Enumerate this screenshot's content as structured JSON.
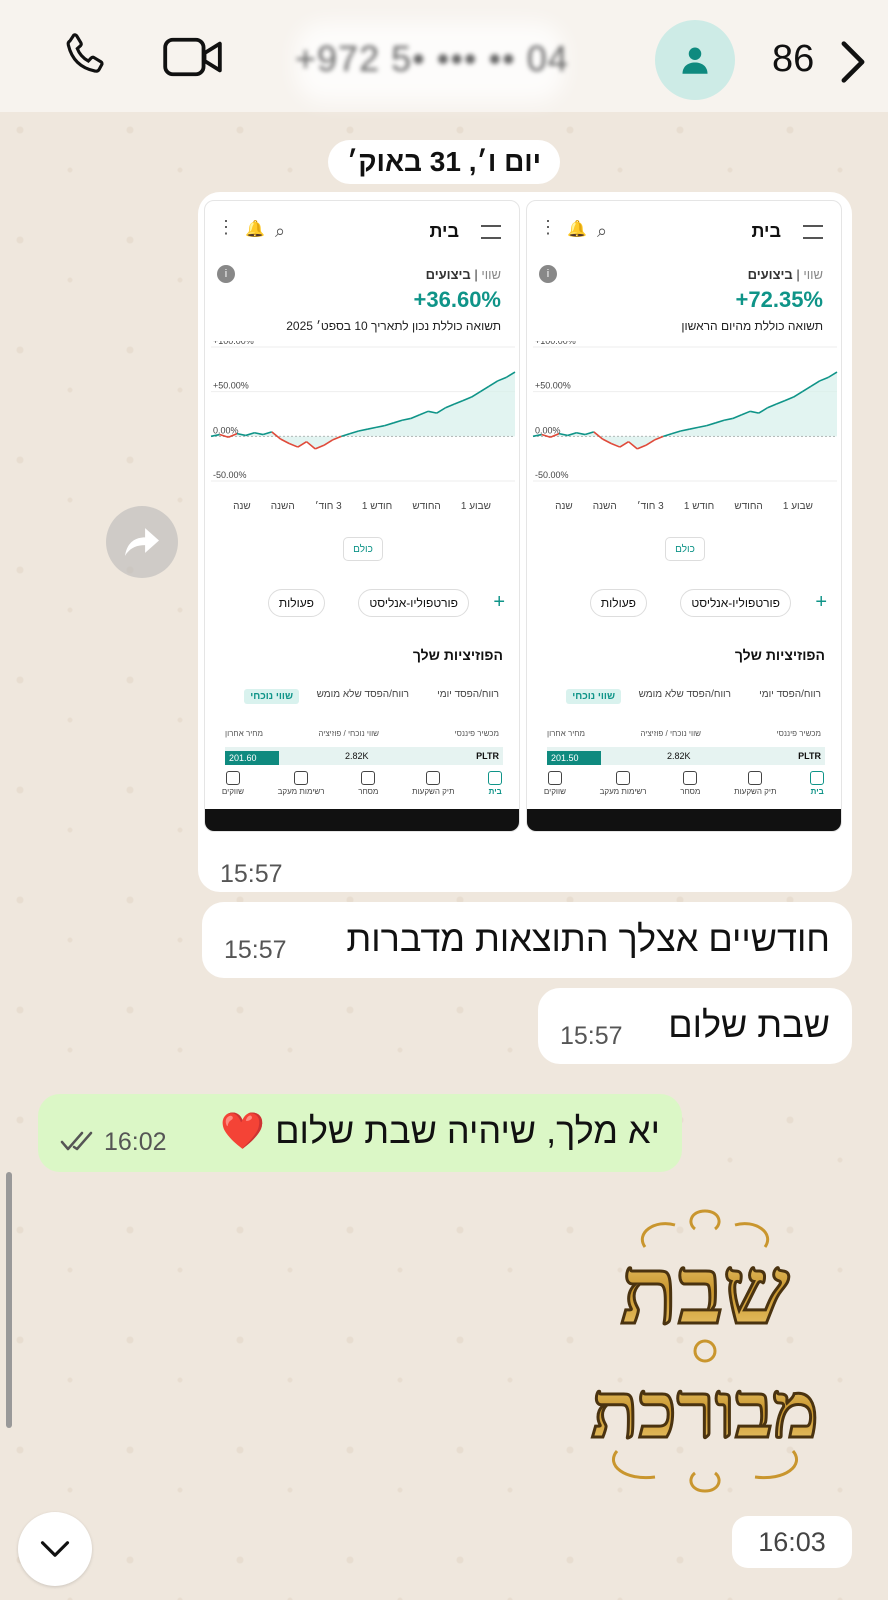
{
  "header": {
    "phone_number": "+972 5• ••• •• 04",
    "unread_count": "86",
    "icons": [
      "phone-icon",
      "video-icon",
      "avatar-icon",
      "chevron-right-icon"
    ]
  },
  "date_separator": "יום ו׳, 31 באוק׳",
  "image_message": {
    "time": "15:57",
    "screenshots": [
      {
        "title": "בית",
        "tab_active": "ביצועים",
        "tab_other": "שווי",
        "percent": "+72.35%",
        "note": "תשואה כוללת מהיום הראשון",
        "y_labels": [
          "+100.00%",
          "+50.00%",
          "0.00%",
          "-50.00%"
        ],
        "chart_data": {
          "type": "line",
          "title": "",
          "ylabel": "",
          "ylim": [
            -50,
            100
          ],
          "series": [
            {
              "values": [
                0,
                2,
                -1,
                3,
                1,
                4,
                2,
                5,
                -3,
                -8,
                -12,
                -6,
                -14,
                -10,
                -4,
                0,
                3,
                6,
                8,
                10,
                12,
                15,
                18,
                20,
                24,
                28,
                26,
                32,
                36,
                40,
                44,
                50,
                56,
                62,
                66,
                72
              ]
            }
          ]
        }
      },
      {
        "title": "בית",
        "tab_active": "ביצועים",
        "tab_other": "שווי",
        "percent": "+36.60%",
        "note": "תשואה כוללת נכון לתאריך 10 בספט׳ 2025",
        "y_labels": [
          "+100.00%",
          "+50.00%",
          "0.00%",
          "-50.00%"
        ],
        "chart_data": {
          "type": "line",
          "title": "",
          "ylabel": "",
          "ylim": [
            -50,
            100
          ],
          "series": [
            {
              "values": [
                0,
                2,
                -1,
                3,
                1,
                4,
                2,
                5,
                -3,
                -8,
                -12,
                -6,
                -14,
                -10,
                -4,
                0,
                3,
                6,
                8,
                10,
                12,
                15,
                18,
                20,
                24,
                28,
                26,
                32,
                36,
                40,
                44,
                50,
                56,
                62,
                66,
                72
              ]
            }
          ]
        }
      }
    ],
    "range_labels": [
      "שבוע 1",
      "החודש",
      "חודש 1",
      "3 חוד׳",
      "השנה",
      "שנה"
    ],
    "all_button": "כולם",
    "chips": [
      "פורטפוליו-אנליסט",
      "פעולות"
    ],
    "positions_title": "הפוזיציות שלך",
    "position_tabs": [
      "רווח/הפסד יומי",
      "רווח/הפסד שלא מומש",
      "שווי נוכחי"
    ],
    "columns": [
      "מכשיר פיננסי",
      "שווי נוכחי / פוזיציה",
      "מחיר אחרון"
    ],
    "row_prices": [
      "201.50",
      "201.60"
    ],
    "row_value": "2.82K",
    "row_symbol": "PLTR",
    "nav": [
      "בית",
      "תיק השקעות",
      "מסחר",
      "רשימות מעקב",
      "שווקים"
    ]
  },
  "messages": [
    {
      "text": "חודשיים אצלך התוצאות מדברות",
      "time": "15:57",
      "direction": "in"
    },
    {
      "text": "שבת שלום",
      "time": "15:57",
      "direction": "in"
    },
    {
      "text": "יא מלך, שיהיה שבת שלום ❤️",
      "time": "16:02",
      "direction": "out"
    }
  ],
  "sticker": {
    "text_line1": "שבת",
    "text_line2": "מבורכת",
    "time": "16:03"
  },
  "colors": {
    "accent": "#0f9488",
    "out_bubble": "#dbf7c6",
    "negative": "#e04a3a"
  }
}
